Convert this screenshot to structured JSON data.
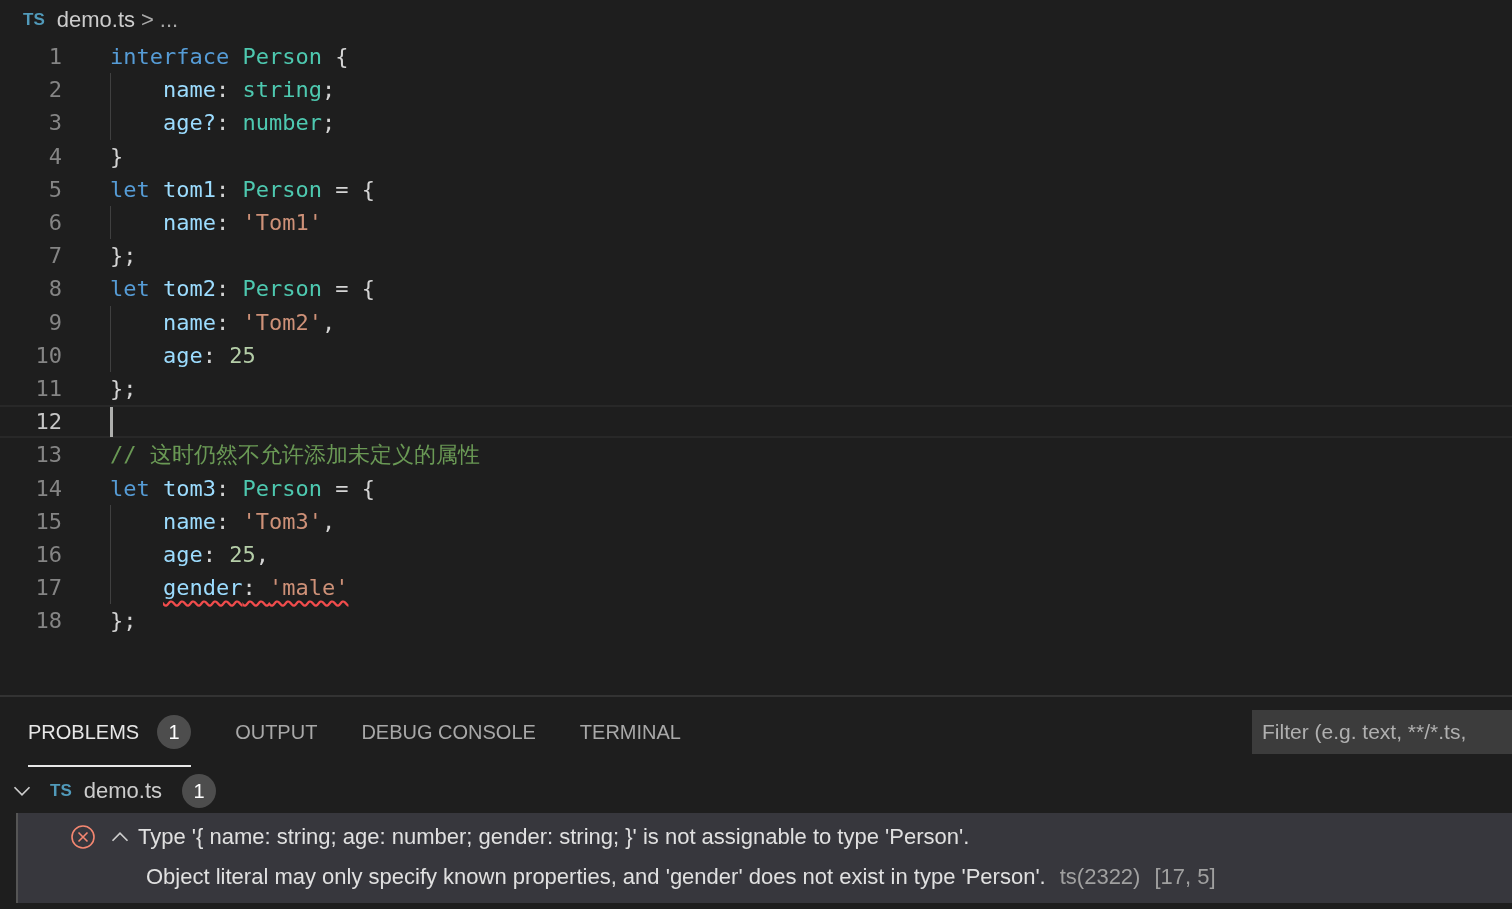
{
  "breadcrumb": {
    "badge": "TS",
    "file": "demo.ts",
    "separator": ">",
    "more": "..."
  },
  "editor": {
    "lines": [
      {
        "number": "1",
        "current": false,
        "indented": false,
        "tokens": [
          {
            "kind": "keyword",
            "text": "interface "
          },
          {
            "kind": "type",
            "text": "Person"
          },
          {
            "kind": "punct",
            "text": " {"
          }
        ]
      },
      {
        "number": "2",
        "current": false,
        "indented": true,
        "tokens": [
          {
            "kind": "var",
            "text": "name"
          },
          {
            "kind": "punct",
            "text": ": "
          },
          {
            "kind": "type",
            "text": "string"
          },
          {
            "kind": "punct",
            "text": ";"
          }
        ]
      },
      {
        "number": "3",
        "current": false,
        "indented": true,
        "tokens": [
          {
            "kind": "var",
            "text": "age?"
          },
          {
            "kind": "punct",
            "text": ": "
          },
          {
            "kind": "type",
            "text": "number"
          },
          {
            "kind": "punct",
            "text": ";"
          }
        ]
      },
      {
        "number": "4",
        "current": false,
        "indented": false,
        "tokens": [
          {
            "kind": "punct",
            "text": "}"
          }
        ]
      },
      {
        "number": "5",
        "current": false,
        "indented": false,
        "tokens": [
          {
            "kind": "keyword",
            "text": "let "
          },
          {
            "kind": "var",
            "text": "tom1"
          },
          {
            "kind": "punct",
            "text": ": "
          },
          {
            "kind": "type",
            "text": "Person"
          },
          {
            "kind": "punct",
            "text": " = {"
          }
        ]
      },
      {
        "number": "6",
        "current": false,
        "indented": true,
        "tokens": [
          {
            "kind": "var",
            "text": "name"
          },
          {
            "kind": "punct",
            "text": ": "
          },
          {
            "kind": "string",
            "text": "'Tom1'"
          }
        ]
      },
      {
        "number": "7",
        "current": false,
        "indented": false,
        "tokens": [
          {
            "kind": "punct",
            "text": "};"
          }
        ]
      },
      {
        "number": "8",
        "current": false,
        "indented": false,
        "tokens": [
          {
            "kind": "keyword",
            "text": "let "
          },
          {
            "kind": "var",
            "text": "tom2"
          },
          {
            "kind": "punct",
            "text": ": "
          },
          {
            "kind": "type",
            "text": "Person"
          },
          {
            "kind": "punct",
            "text": " = {"
          }
        ]
      },
      {
        "number": "9",
        "current": false,
        "indented": true,
        "tokens": [
          {
            "kind": "var",
            "text": "name"
          },
          {
            "kind": "punct",
            "text": ": "
          },
          {
            "kind": "string",
            "text": "'Tom2'"
          },
          {
            "kind": "punct",
            "text": ","
          }
        ]
      },
      {
        "number": "10",
        "current": false,
        "indented": true,
        "tokens": [
          {
            "kind": "var",
            "text": "age"
          },
          {
            "kind": "punct",
            "text": ": "
          },
          {
            "kind": "number",
            "text": "25"
          }
        ]
      },
      {
        "number": "11",
        "current": false,
        "indented": false,
        "tokens": [
          {
            "kind": "punct",
            "text": "};"
          }
        ]
      },
      {
        "number": "12",
        "current": true,
        "indented": false
      },
      {
        "number": "13",
        "current": false,
        "indented": false,
        "tokens": [
          {
            "kind": "comment",
            "text": "// 这时仍然不允许添加未定义的属性"
          }
        ]
      },
      {
        "number": "14",
        "current": false,
        "indented": false,
        "tokens": [
          {
            "kind": "keyword",
            "text": "let "
          },
          {
            "kind": "var",
            "text": "tom3"
          },
          {
            "kind": "punct",
            "text": ": "
          },
          {
            "kind": "type",
            "text": "Person"
          },
          {
            "kind": "punct",
            "text": " = {"
          }
        ]
      },
      {
        "number": "15",
        "current": false,
        "indented": true,
        "tokens": [
          {
            "kind": "var",
            "text": "name"
          },
          {
            "kind": "punct",
            "text": ": "
          },
          {
            "kind": "string",
            "text": "'Tom3'"
          },
          {
            "kind": "punct",
            "text": ","
          }
        ]
      },
      {
        "number": "16",
        "current": false,
        "indented": true,
        "tokens": [
          {
            "kind": "var",
            "text": "age"
          },
          {
            "kind": "punct",
            "text": ": "
          },
          {
            "kind": "number",
            "text": "25"
          },
          {
            "kind": "punct",
            "text": ","
          }
        ]
      },
      {
        "number": "17",
        "current": false,
        "indented": true,
        "error": true,
        "tokens": [
          {
            "kind": "var",
            "text": "gender"
          },
          {
            "kind": "punct",
            "text": ": "
          },
          {
            "kind": "string",
            "text": "'male'"
          }
        ]
      },
      {
        "number": "18",
        "current": false,
        "indented": false,
        "tokens": [
          {
            "kind": "punct",
            "text": "};"
          }
        ]
      }
    ]
  },
  "panel": {
    "tabs": [
      {
        "label": "PROBLEMS",
        "selected": true,
        "count": "1"
      },
      {
        "label": "OUTPUT",
        "selected": false
      },
      {
        "label": "DEBUG CONSOLE",
        "selected": false
      },
      {
        "label": "TERMINAL",
        "selected": false
      }
    ],
    "filter": {
      "placeholder": "Filter (e.g. text, **/*.ts,"
    },
    "file_group": {
      "expanded": true,
      "badge": "TS",
      "file": "demo.ts",
      "count": "1",
      "problems": [
        {
          "expanded": true,
          "message": "Type '{ name: string; age: number; gender: string; }' is not assignable to type 'Person'.",
          "detail": "Object literal may only specify known properties, and 'gender' does not exist in type 'Person'.",
          "code": "ts(2322)",
          "position": "[17, 5]"
        }
      ]
    }
  }
}
